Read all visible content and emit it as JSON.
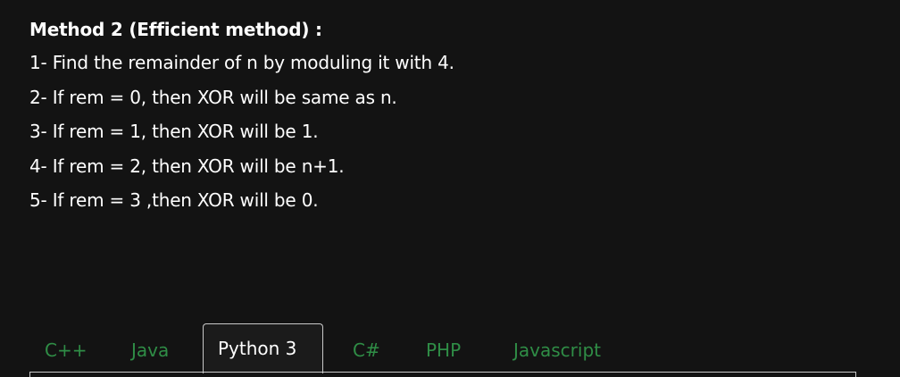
{
  "article": {
    "heading": "Method 2 (Efficient method) :",
    "steps": [
      "1- Find the remainder of n by moduling it with 4.",
      "2- If rem = 0, then XOR will be same as n.",
      "3- If rem = 1, then XOR will be 1.",
      "4- If rem = 2, then XOR will be n+1.",
      "5- If rem = 3 ,then XOR will be 0."
    ]
  },
  "code_tabs": {
    "tabs": [
      "C++",
      "Java",
      "Python 3",
      "C#",
      "PHP",
      "Javascript"
    ],
    "active": "Python 3"
  },
  "colors": {
    "background": "#131313",
    "text": "#ffffff",
    "tab_link": "#2f8d46",
    "tab_border": "#c8c8c8"
  }
}
